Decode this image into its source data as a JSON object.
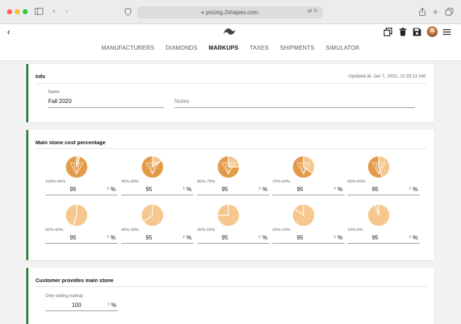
{
  "browser": {
    "url": "pricing.2shapes.com",
    "reader_icon": "translate-icon",
    "reload_icon": "reload-icon"
  },
  "header": {
    "nav": [
      "MANUFACTURERS",
      "DIAMONDS",
      "MARKUPS",
      "TAXES",
      "SHIPMENTS",
      "SIMULATOR"
    ],
    "active_nav": "MARKUPS"
  },
  "info": {
    "title": "Info",
    "updated": "Updated at: Jan 7, 2021, 11:33:12 AM",
    "name_label": "Name",
    "name_value": "Fall 2020",
    "notes_placeholder": "Notes"
  },
  "main_stone": {
    "title": "Main stone cost percentage",
    "stones": [
      {
        "range": "100%-90%",
        "value": "95",
        "fill": 0.95
      },
      {
        "range": "90%-80%",
        "value": "95",
        "fill": 0.85
      },
      {
        "range": "80%-70%",
        "value": "95",
        "fill": 0.75
      },
      {
        "range": "70%-60%",
        "value": "95",
        "fill": 0.65
      },
      {
        "range": "60%-50%",
        "value": "95",
        "fill": 0.55
      },
      {
        "range": "50%-40%",
        "value": "95",
        "fill": 0.45
      },
      {
        "range": "40%-30%",
        "value": "95",
        "fill": 0.35
      },
      {
        "range": "30%-20%",
        "value": "95",
        "fill": 0.25
      },
      {
        "range": "20%-10%",
        "value": "95",
        "fill": 0.15
      },
      {
        "range": "10%-0%",
        "value": "95",
        "fill": 0.05
      }
    ],
    "unit": "%",
    "spin_glyph": "⇕"
  },
  "customer": {
    "title": "Customer provides main stone",
    "label": "Only setting markup",
    "value": "100",
    "unit": "%",
    "spin_glyph": "⇕"
  },
  "colors": {
    "accent": "#2e7d32",
    "gem_light": "#f6c78f",
    "gem_dark": "#e39b4a"
  }
}
